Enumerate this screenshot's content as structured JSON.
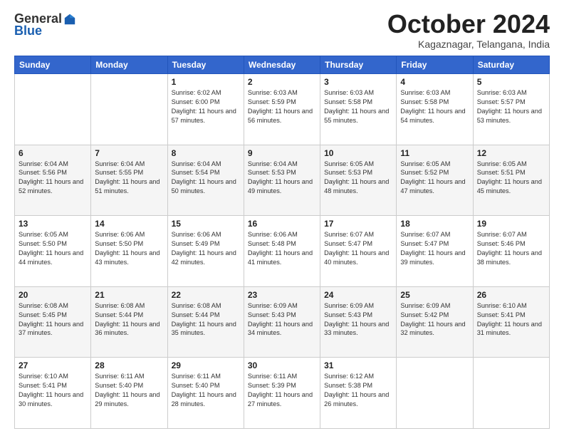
{
  "header": {
    "logo": {
      "general": "General",
      "blue": "Blue",
      "tagline": ""
    },
    "title": "October 2024",
    "location": "Kagaznagar, Telangana, India"
  },
  "weekdays": [
    "Sunday",
    "Monday",
    "Tuesday",
    "Wednesday",
    "Thursday",
    "Friday",
    "Saturday"
  ],
  "weeks": [
    [
      {
        "day": null
      },
      {
        "day": null
      },
      {
        "day": "1",
        "sunrise": "6:02 AM",
        "sunset": "6:00 PM",
        "daylight": "11 hours and 57 minutes."
      },
      {
        "day": "2",
        "sunrise": "6:03 AM",
        "sunset": "5:59 PM",
        "daylight": "11 hours and 56 minutes."
      },
      {
        "day": "3",
        "sunrise": "6:03 AM",
        "sunset": "5:58 PM",
        "daylight": "11 hours and 55 minutes."
      },
      {
        "day": "4",
        "sunrise": "6:03 AM",
        "sunset": "5:58 PM",
        "daylight": "11 hours and 54 minutes."
      },
      {
        "day": "5",
        "sunrise": "6:03 AM",
        "sunset": "5:57 PM",
        "daylight": "11 hours and 53 minutes."
      }
    ],
    [
      {
        "day": "6",
        "sunrise": "6:04 AM",
        "sunset": "5:56 PM",
        "daylight": "11 hours and 52 minutes."
      },
      {
        "day": "7",
        "sunrise": "6:04 AM",
        "sunset": "5:55 PM",
        "daylight": "11 hours and 51 minutes."
      },
      {
        "day": "8",
        "sunrise": "6:04 AM",
        "sunset": "5:54 PM",
        "daylight": "11 hours and 50 minutes."
      },
      {
        "day": "9",
        "sunrise": "6:04 AM",
        "sunset": "5:53 PM",
        "daylight": "11 hours and 49 minutes."
      },
      {
        "day": "10",
        "sunrise": "6:05 AM",
        "sunset": "5:53 PM",
        "daylight": "11 hours and 48 minutes."
      },
      {
        "day": "11",
        "sunrise": "6:05 AM",
        "sunset": "5:52 PM",
        "daylight": "11 hours and 47 minutes."
      },
      {
        "day": "12",
        "sunrise": "6:05 AM",
        "sunset": "5:51 PM",
        "daylight": "11 hours and 45 minutes."
      }
    ],
    [
      {
        "day": "13",
        "sunrise": "6:05 AM",
        "sunset": "5:50 PM",
        "daylight": "11 hours and 44 minutes."
      },
      {
        "day": "14",
        "sunrise": "6:06 AM",
        "sunset": "5:50 PM",
        "daylight": "11 hours and 43 minutes."
      },
      {
        "day": "15",
        "sunrise": "6:06 AM",
        "sunset": "5:49 PM",
        "daylight": "11 hours and 42 minutes."
      },
      {
        "day": "16",
        "sunrise": "6:06 AM",
        "sunset": "5:48 PM",
        "daylight": "11 hours and 41 minutes."
      },
      {
        "day": "17",
        "sunrise": "6:07 AM",
        "sunset": "5:47 PM",
        "daylight": "11 hours and 40 minutes."
      },
      {
        "day": "18",
        "sunrise": "6:07 AM",
        "sunset": "5:47 PM",
        "daylight": "11 hours and 39 minutes."
      },
      {
        "day": "19",
        "sunrise": "6:07 AM",
        "sunset": "5:46 PM",
        "daylight": "11 hours and 38 minutes."
      }
    ],
    [
      {
        "day": "20",
        "sunrise": "6:08 AM",
        "sunset": "5:45 PM",
        "daylight": "11 hours and 37 minutes."
      },
      {
        "day": "21",
        "sunrise": "6:08 AM",
        "sunset": "5:44 PM",
        "daylight": "11 hours and 36 minutes."
      },
      {
        "day": "22",
        "sunrise": "6:08 AM",
        "sunset": "5:44 PM",
        "daylight": "11 hours and 35 minutes."
      },
      {
        "day": "23",
        "sunrise": "6:09 AM",
        "sunset": "5:43 PM",
        "daylight": "11 hours and 34 minutes."
      },
      {
        "day": "24",
        "sunrise": "6:09 AM",
        "sunset": "5:43 PM",
        "daylight": "11 hours and 33 minutes."
      },
      {
        "day": "25",
        "sunrise": "6:09 AM",
        "sunset": "5:42 PM",
        "daylight": "11 hours and 32 minutes."
      },
      {
        "day": "26",
        "sunrise": "6:10 AM",
        "sunset": "5:41 PM",
        "daylight": "11 hours and 31 minutes."
      }
    ],
    [
      {
        "day": "27",
        "sunrise": "6:10 AM",
        "sunset": "5:41 PM",
        "daylight": "11 hours and 30 minutes."
      },
      {
        "day": "28",
        "sunrise": "6:11 AM",
        "sunset": "5:40 PM",
        "daylight": "11 hours and 29 minutes."
      },
      {
        "day": "29",
        "sunrise": "6:11 AM",
        "sunset": "5:40 PM",
        "daylight": "11 hours and 28 minutes."
      },
      {
        "day": "30",
        "sunrise": "6:11 AM",
        "sunset": "5:39 PM",
        "daylight": "11 hours and 27 minutes."
      },
      {
        "day": "31",
        "sunrise": "6:12 AM",
        "sunset": "5:38 PM",
        "daylight": "11 hours and 26 minutes."
      },
      {
        "day": null
      },
      {
        "day": null
      }
    ]
  ]
}
